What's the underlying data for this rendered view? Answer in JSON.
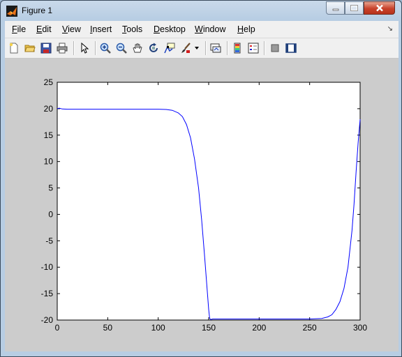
{
  "window": {
    "title": "Figure 1"
  },
  "menu": [
    "File",
    "Edit",
    "View",
    "Insert",
    "Tools",
    "Desktop",
    "Window",
    "Help"
  ],
  "toolbar": {
    "items": [
      "new-figure",
      "open-file",
      "save-figure",
      "print-figure",
      "select-arrow",
      "zoom-in",
      "zoom-out",
      "pan",
      "rotate-3d",
      "data-cursor",
      "brush",
      "brush-dropdown",
      "link-plot",
      "insert-colorbar",
      "insert-legend",
      "hide-plot-tools",
      "show-plot-tools"
    ]
  },
  "colors": {
    "line": "#0000ff",
    "figure_bg": "#cccccc",
    "axes_bg": "#ffffff"
  },
  "chart_data": {
    "type": "line",
    "title": "",
    "xlabel": "",
    "ylabel": "",
    "xlim": [
      0,
      300
    ],
    "ylim": [
      -20,
      25
    ],
    "xticks": [
      "0",
      "50",
      "100",
      "150",
      "200",
      "250",
      "300"
    ],
    "yticks": [
      "25",
      "20",
      "15",
      "10",
      "5",
      "0",
      "-5",
      "-10",
      "-15",
      "-20"
    ],
    "grid": false,
    "series": [
      {
        "x": [
          0,
          2,
          5,
          10,
          50,
          100,
          108,
          114,
          120,
          124,
          128,
          132,
          136,
          140,
          143,
          146,
          148,
          150,
          151,
          152,
          154,
          160,
          200,
          250,
          262,
          268,
          272,
          276,
          280,
          284,
          288,
          292,
          294,
          296,
          298,
          300
        ],
        "y": [
          20,
          20.1,
          19.95,
          19.9,
          19.9,
          19.9,
          19.85,
          19.7,
          19.2,
          18.5,
          17,
          14.5,
          10.5,
          5,
          -1,
          -8,
          -13,
          -18,
          -19.7,
          -19.9,
          -19.8,
          -19.8,
          -19.8,
          -19.8,
          -19.7,
          -19.4,
          -19,
          -18,
          -16.5,
          -14,
          -10,
          -3,
          2,
          8,
          13.5,
          18
        ]
      }
    ]
  }
}
